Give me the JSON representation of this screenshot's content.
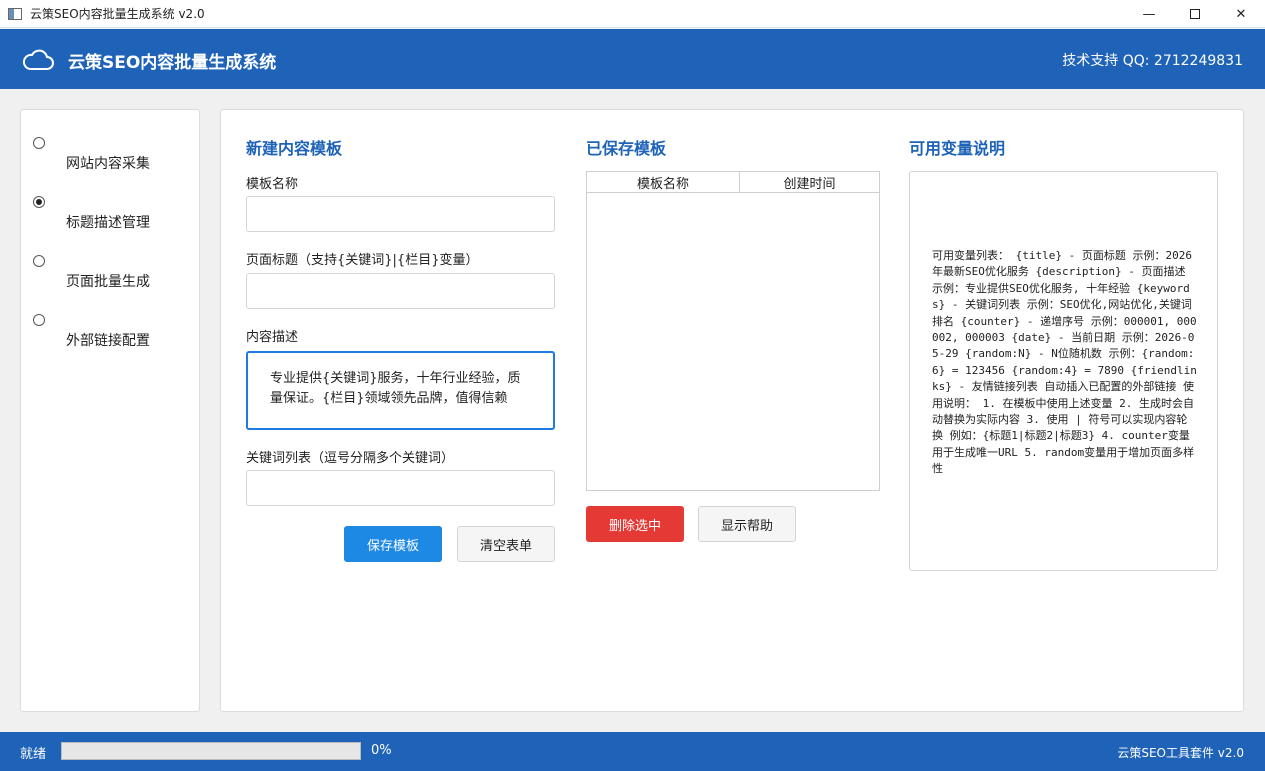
{
  "window": {
    "title": "云策SEO内容批量生成系统 v2.0"
  },
  "header": {
    "app_name": "云策SEO内容批量生成系统",
    "support": "技术支持 QQ: 2712249831"
  },
  "sidebar": {
    "items": [
      {
        "label": "网站内容采集",
        "selected": false
      },
      {
        "label": "标题描述管理",
        "selected": true
      },
      {
        "label": "页面批量生成",
        "selected": false
      },
      {
        "label": "外部链接配置",
        "selected": false
      }
    ]
  },
  "new_template": {
    "title": "新建内容模板",
    "name_label": "模板名称",
    "name_value": "",
    "page_title_label": "页面标题（支持{关键词}|{栏目}变量）",
    "page_title_value": "",
    "desc_label": "内容描述",
    "desc_value": "专业提供{关键词}服务，十年行业经验，质量保证。{栏目}领域领先品牌，值得信赖",
    "keywords_label": "关键词列表（逗号分隔多个关键词）",
    "keywords_value": "",
    "save_label": "保存模板",
    "clear_label": "清空表单"
  },
  "saved_templates": {
    "title": "已保存模板",
    "columns": [
      "模板名称",
      "创建时间"
    ],
    "rows": [],
    "delete_label": "删除选中",
    "help_label": "显示帮助"
  },
  "variables": {
    "title": "可用变量说明",
    "text": "可用变量列表：  {title} - 页面标题 示例：2026年最新SEO优化服务   {description} - 页面描述 示例：专业提供SEO优化服务, 十年经验  {keywords} - 关键词列表 示例：SEO优化,网站优化,关键词排名  {counter} - 递增序号 示例：000001, 000002, 000003  {date} - 当前日期 示例：2026-05-29  {random:N} - N位随机数 示例：{random:6} = 123456 {random:4} = 7890  {friendlinks} - 友情链接列表 自动插入已配置的外部链接  使用说明： 1. 在模板中使用上述变量 2. 生成时会自动替换为实际内容 3. 使用 | 符号可以实现内容轮换     例如：{标题1|标题2|标题3} 4. counter变量用于生成唯一URL 5. random变量用于增加页面多样性"
  },
  "statusbar": {
    "status": "就绪",
    "progress": 0,
    "progress_text": "0%",
    "version": "云策SEO工具套件 v2.0"
  }
}
